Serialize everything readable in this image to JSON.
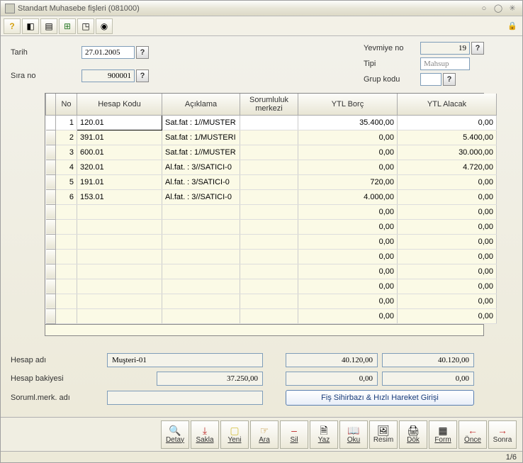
{
  "title": "Standart Muhasebe fişleri (081000)",
  "form": {
    "tarih_label": "Tarih",
    "tarih_value": "27.01.2005",
    "sirano_label": "Sıra no",
    "sirano_value": "900001",
    "yevmiye_label": "Yevmiye no",
    "yevmiye_value": "19",
    "tipi_label": "Tipi",
    "tipi_value": "Mahsup",
    "grup_label": "Grup kodu",
    "grup_value": ""
  },
  "grid": {
    "headers": {
      "no": "No",
      "hesap": "Hesap Kodu",
      "acik": "Açıklama",
      "sorum": "Sorumluluk merkezi",
      "borc": "YTL Borç",
      "alacak": "YTL Alacak"
    },
    "rows": [
      {
        "no": "1",
        "hesap": "120.01",
        "acik": "Sat.fat : 1//MUSTER",
        "sorum": "",
        "borc": "35.400,00",
        "alacak": "0,00",
        "sel": true
      },
      {
        "no": "2",
        "hesap": "391.01",
        "acik": "Sat.fat : 1/MUSTERI",
        "sorum": "",
        "borc": "0,00",
        "alacak": "5.400,00"
      },
      {
        "no": "3",
        "hesap": "600.01",
        "acik": "Sat.fat : 1//MUSTER",
        "sorum": "",
        "borc": "0,00",
        "alacak": "30.000,00"
      },
      {
        "no": "4",
        "hesap": "320.01",
        "acik": "Al.fat. : 3//SATICI-0",
        "sorum": "",
        "borc": "0,00",
        "alacak": "4.720,00"
      },
      {
        "no": "5",
        "hesap": "191.01",
        "acik": "Al.fat. : 3/SATICI-0",
        "sorum": "",
        "borc": "720,00",
        "alacak": "0,00"
      },
      {
        "no": "6",
        "hesap": "153.01",
        "acik": "Al.fat. : 3//SATICI-0",
        "sorum": "",
        "borc": "4.000,00",
        "alacak": "0,00"
      },
      {
        "no": "",
        "hesap": "",
        "acik": "",
        "sorum": "",
        "borc": "0,00",
        "alacak": "0,00"
      },
      {
        "no": "",
        "hesap": "",
        "acik": "",
        "sorum": "",
        "borc": "0,00",
        "alacak": "0,00"
      },
      {
        "no": "",
        "hesap": "",
        "acik": "",
        "sorum": "",
        "borc": "0,00",
        "alacak": "0,00"
      },
      {
        "no": "",
        "hesap": "",
        "acik": "",
        "sorum": "",
        "borc": "0,00",
        "alacak": "0,00"
      },
      {
        "no": "",
        "hesap": "",
        "acik": "",
        "sorum": "",
        "borc": "0,00",
        "alacak": "0,00"
      },
      {
        "no": "",
        "hesap": "",
        "acik": "",
        "sorum": "",
        "borc": "0,00",
        "alacak": "0,00"
      },
      {
        "no": "",
        "hesap": "",
        "acik": "",
        "sorum": "",
        "borc": "0,00",
        "alacak": "0,00"
      },
      {
        "no": "",
        "hesap": "",
        "acik": "",
        "sorum": "",
        "borc": "0,00",
        "alacak": "0,00"
      }
    ]
  },
  "bottom": {
    "hesap_adi_label": "Hesap adı",
    "hesap_adi_value": "Muşteri-01",
    "hesap_bakiyesi_label": "Hesap bakiyesi",
    "hesap_bakiyesi_value": "37.250,00",
    "soruml_label": "Soruml.merk. adı",
    "soruml_value": "",
    "total_borc": "40.120,00",
    "total_alacak": "40.120,00",
    "diff_borc": "0,00",
    "diff_alacak": "0,00",
    "wizard_label": "Fiş Sihirbazı & Hızlı Hareket Girişi"
  },
  "footer": {
    "detay": "Detay",
    "sakla": "Sakla",
    "yeni": "Yeni",
    "ara": "Ara",
    "sil": "Sil",
    "yaz": "Yaz",
    "oku": "Oku",
    "resim": "Resim",
    "dok": "Dök",
    "form": "Form",
    "once": "Önce",
    "sonra": "Sonra"
  },
  "status": "1/6",
  "q": "?"
}
